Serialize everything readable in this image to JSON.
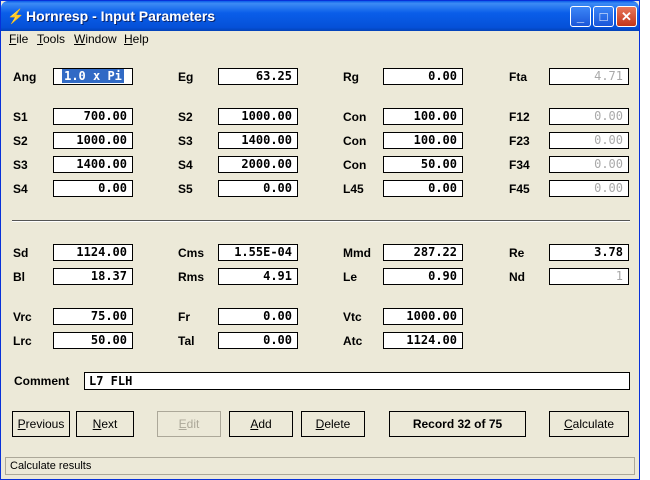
{
  "window": {
    "title": "Hornresp - Input Parameters"
  },
  "menu": [
    {
      "key": "F",
      "rest": "ile"
    },
    {
      "key": "T",
      "rest": "ools"
    },
    {
      "key": "W",
      "rest": "indow"
    },
    {
      "key": "H",
      "rest": "elp"
    }
  ],
  "fields": {
    "ang": {
      "label": "Ang",
      "value": "1.0 x Pi"
    },
    "eg": {
      "label": "Eg",
      "value": "63.25"
    },
    "rg": {
      "label": "Rg",
      "value": "0.00"
    },
    "fta": {
      "label": "Fta",
      "value": "4.71"
    },
    "s1": {
      "label": "S1",
      "value": "700.00"
    },
    "s2b": {
      "label": "S2",
      "value": "1000.00"
    },
    "con1": {
      "label": "Con",
      "value": "100.00"
    },
    "f12": {
      "label": "F12",
      "value": "0.00"
    },
    "s2": {
      "label": "S2",
      "value": "1000.00"
    },
    "s3b": {
      "label": "S3",
      "value": "1400.00"
    },
    "con2": {
      "label": "Con",
      "value": "100.00"
    },
    "f23": {
      "label": "F23",
      "value": "0.00"
    },
    "s3": {
      "label": "S3",
      "value": "1400.00"
    },
    "s4b": {
      "label": "S4",
      "value": "2000.00"
    },
    "con3": {
      "label": "Con",
      "value": "50.00"
    },
    "f34": {
      "label": "F34",
      "value": "0.00"
    },
    "s4": {
      "label": "S4",
      "value": "0.00"
    },
    "s5": {
      "label": "S5",
      "value": "0.00"
    },
    "l45": {
      "label": "L45",
      "value": "0.00"
    },
    "f45": {
      "label": "F45",
      "value": "0.00"
    },
    "sd": {
      "label": "Sd",
      "value": "1124.00"
    },
    "cms": {
      "label": "Cms",
      "value": "1.55E-04"
    },
    "mmd": {
      "label": "Mmd",
      "value": "287.22"
    },
    "re": {
      "label": "Re",
      "value": "3.78"
    },
    "bl": {
      "label": "Bl",
      "value": "18.37"
    },
    "rms": {
      "label": "Rms",
      "value": "4.91"
    },
    "le": {
      "label": "Le",
      "value": "0.90"
    },
    "nd": {
      "label": "Nd",
      "value": "1"
    },
    "vrc": {
      "label": "Vrc",
      "value": "75.00"
    },
    "fr": {
      "label": "Fr",
      "value": "0.00"
    },
    "vtc": {
      "label": "Vtc",
      "value": "1000.00"
    },
    "lrc": {
      "label": "Lrc",
      "value": "50.00"
    },
    "tal": {
      "label": "Tal",
      "value": "0.00"
    },
    "atc": {
      "label": "Atc",
      "value": "1124.00"
    }
  },
  "comment": {
    "label": "Comment",
    "value": "L7 FLH"
  },
  "buttons": {
    "previous": {
      "key": "P",
      "rest": "revious"
    },
    "next": {
      "key": "N",
      "rest": "ext"
    },
    "edit": {
      "key": "E",
      "rest": "dit"
    },
    "add": {
      "key": "A",
      "rest": "dd"
    },
    "delete": {
      "key": "D",
      "rest": "elete"
    },
    "calculate": {
      "key": "C",
      "rest": "alculate"
    }
  },
  "record": "Record 32 of 75",
  "status": "Calculate results",
  "colors": {
    "titlebar": "#0a5ee9",
    "face": "#ece9d8",
    "selection": "#316ac5",
    "disabled": "#a9a9a9"
  }
}
